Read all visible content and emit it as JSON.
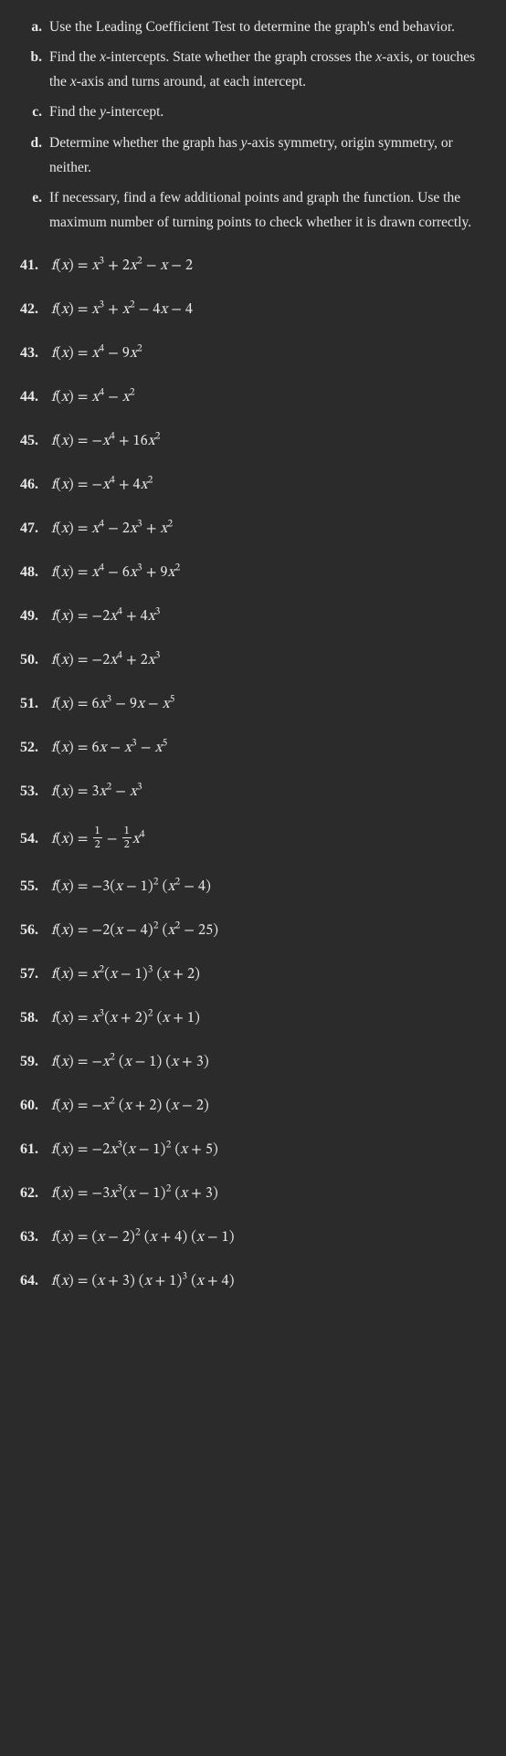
{
  "instructions": [
    {
      "letter": "a.",
      "text": "Use the Leading Coefficient Test to determine the graph's end behavior."
    },
    {
      "letter": "b.",
      "text": "Find the <span class=\"italic\">x</span>-intercepts. State whether the graph crosses the <span class=\"italic\">x</span>-axis, or touches the <span class=\"italic\">x</span>-axis and turns around, at each intercept."
    },
    {
      "letter": "c.",
      "text": "Find the <span class=\"italic\">y</span>-intercept."
    },
    {
      "letter": "d.",
      "text": "Determine whether the graph has <span class=\"italic\">y</span>-axis symmetry, origin symmetry, or neither."
    },
    {
      "letter": "e.",
      "text": "If necessary, find a few additional points and graph the function. Use the maximum number of turning points to check whether it is drawn correctly."
    }
  ],
  "problems": [
    {
      "num": "41.",
      "eqn": "f<span class=\"n\">(</span>x<span class=\"n\">)</span> <span class=\"n\">=</span> x<sup>3</sup> <span class=\"n\">+ 2</span>x<sup>2</sup> <span class=\"n\">−</span> x <span class=\"n\">− 2</span>"
    },
    {
      "num": "42.",
      "eqn": "f<span class=\"n\">(</span>x<span class=\"n\">)</span> <span class=\"n\">=</span> x<sup>3</sup> <span class=\"n\">+</span> x<sup>2</sup> <span class=\"n\">− 4</span>x <span class=\"n\">− 4</span>"
    },
    {
      "num": "43.",
      "eqn": "f<span class=\"n\">(</span>x<span class=\"n\">)</span> <span class=\"n\">=</span> x<sup>4</sup> <span class=\"n\">− 9</span>x<sup>2</sup>"
    },
    {
      "num": "44.",
      "eqn": "f<span class=\"n\">(</span>x<span class=\"n\">)</span> <span class=\"n\">=</span> x<sup>4</sup> <span class=\"n\">−</span> x<sup>2</sup>"
    },
    {
      "num": "45.",
      "eqn": "f<span class=\"n\">(</span>x<span class=\"n\">)</span> <span class=\"n\">= −</span>x<sup>4</sup> <span class=\"n\">+ 16</span>x<sup>2</sup>"
    },
    {
      "num": "46.",
      "eqn": "f<span class=\"n\">(</span>x<span class=\"n\">)</span> <span class=\"n\">= −</span>x<sup>4</sup> <span class=\"n\">+ 4</span>x<sup>2</sup>"
    },
    {
      "num": "47.",
      "eqn": "f<span class=\"n\">(</span>x<span class=\"n\">)</span> <span class=\"n\">=</span> x<sup>4</sup> <span class=\"n\">− 2</span>x<sup>3</sup> <span class=\"n\">+</span> x<sup>2</sup>"
    },
    {
      "num": "48.",
      "eqn": "f<span class=\"n\">(</span>x<span class=\"n\">)</span> <span class=\"n\">=</span> x<sup>4</sup> <span class=\"n\">− 6</span>x<sup>3</sup> <span class=\"n\">+ 9</span>x<sup>2</sup>"
    },
    {
      "num": "49.",
      "eqn": "f<span class=\"n\">(</span>x<span class=\"n\">)</span> <span class=\"n\">= −2</span>x<sup>4</sup> <span class=\"n\">+ 4</span>x<sup>3</sup>"
    },
    {
      "num": "50.",
      "eqn": "f<span class=\"n\">(</span>x<span class=\"n\">)</span> <span class=\"n\">= −2</span>x<sup>4</sup> <span class=\"n\">+ 2</span>x<sup>3</sup>"
    },
    {
      "num": "51.",
      "eqn": "f<span class=\"n\">(</span>x<span class=\"n\">)</span> <span class=\"n\">= 6</span>x<sup>3</sup> <span class=\"n\">− 9</span>x <span class=\"n\">−</span> x<sup>5</sup>"
    },
    {
      "num": "52.",
      "eqn": "f<span class=\"n\">(</span>x<span class=\"n\">)</span> <span class=\"n\">= 6</span>x <span class=\"n\">−</span> x<sup>3</sup> <span class=\"n\">−</span> x<sup>5</sup>"
    },
    {
      "num": "53.",
      "eqn": "f<span class=\"n\">(</span>x<span class=\"n\">)</span> <span class=\"n\">= 3</span>x<sup>2</sup> <span class=\"n\">−</span> x<sup>3</sup>"
    },
    {
      "num": "54.",
      "eqn": "f<span class=\"n\">(</span>x<span class=\"n\">)</span> <span class=\"n\">=</span> <span class=\"frac\"><span class=\"fn\">1</span><span class=\"fd\">2</span></span> <span class=\"n\">−</span> <span class=\"frac\"><span class=\"fn\">1</span><span class=\"fd\">2</span></span>x<sup>4</sup>"
    },
    {
      "num": "55.",
      "eqn": "f<span class=\"n\">(</span>x<span class=\"n\">)</span> <span class=\"n\">= −3(</span>x <span class=\"n\">− 1)</span><sup>2</sup> <span class=\"n\">(</span>x<sup>2</sup> <span class=\"n\">− 4)</span>"
    },
    {
      "num": "56.",
      "eqn": "f<span class=\"n\">(</span>x<span class=\"n\">)</span> <span class=\"n\">= −2(</span>x <span class=\"n\">− 4)</span><sup>2</sup> <span class=\"n\">(</span>x<sup>2</sup> <span class=\"n\">− 25)</span>"
    },
    {
      "num": "57.",
      "eqn": "f<span class=\"n\">(</span>x<span class=\"n\">)</span> <span class=\"n\">=</span> x<sup>2</sup><span class=\"n\">(</span>x <span class=\"n\">− 1)</span><sup>3</sup> <span class=\"n\">(</span>x <span class=\"n\">+ 2)</span>"
    },
    {
      "num": "58.",
      "eqn": "f<span class=\"n\">(</span>x<span class=\"n\">)</span> <span class=\"n\">=</span> x<sup>3</sup><span class=\"n\">(</span>x <span class=\"n\">+ 2)</span><sup>2</sup> <span class=\"n\">(</span>x <span class=\"n\">+ 1)</span>"
    },
    {
      "num": "59.",
      "eqn": "f<span class=\"n\">(</span>x<span class=\"n\">)</span> <span class=\"n\">= −</span>x<sup>2</sup> <span class=\"n\">(</span>x <span class=\"n\">− 1) (</span>x <span class=\"n\">+ 3)</span>"
    },
    {
      "num": "60.",
      "eqn": "f<span class=\"n\">(</span>x<span class=\"n\">)</span> <span class=\"n\">= −</span>x<sup>2</sup> <span class=\"n\">(</span>x <span class=\"n\">+ 2) (</span>x <span class=\"n\">− 2)</span>"
    },
    {
      "num": "61.",
      "eqn": "f<span class=\"n\">(</span>x<span class=\"n\">)</span> <span class=\"n\">= −2</span>x<sup>3</sup><span class=\"n\">(</span>x <span class=\"n\">− 1)</span><sup>2</sup> <span class=\"n\">(</span>x <span class=\"n\">+ 5)</span>"
    },
    {
      "num": "62.",
      "eqn": "f<span class=\"n\">(</span>x<span class=\"n\">)</span> <span class=\"n\">= −3</span>x<sup>3</sup><span class=\"n\">(</span>x <span class=\"n\">− 1)</span><sup>2</sup> <span class=\"n\">(</span>x <span class=\"n\">+ 3)</span>"
    },
    {
      "num": "63.",
      "eqn": "f<span class=\"n\">(</span>x<span class=\"n\">)</span> <span class=\"n\">= (</span>x <span class=\"n\">− 2)</span><sup>2</sup> <span class=\"n\">(</span>x <span class=\"n\">+ 4) (</span>x <span class=\"n\">− 1)</span>"
    },
    {
      "num": "64.",
      "eqn": "f<span class=\"n\">(</span>x<span class=\"n\">)</span> <span class=\"n\">= (</span>x <span class=\"n\">+ 3) (</span>x <span class=\"n\">+ 1)</span><sup>3</sup> <span class=\"n\">(</span>x <span class=\"n\">+ 4)</span>"
    }
  ]
}
